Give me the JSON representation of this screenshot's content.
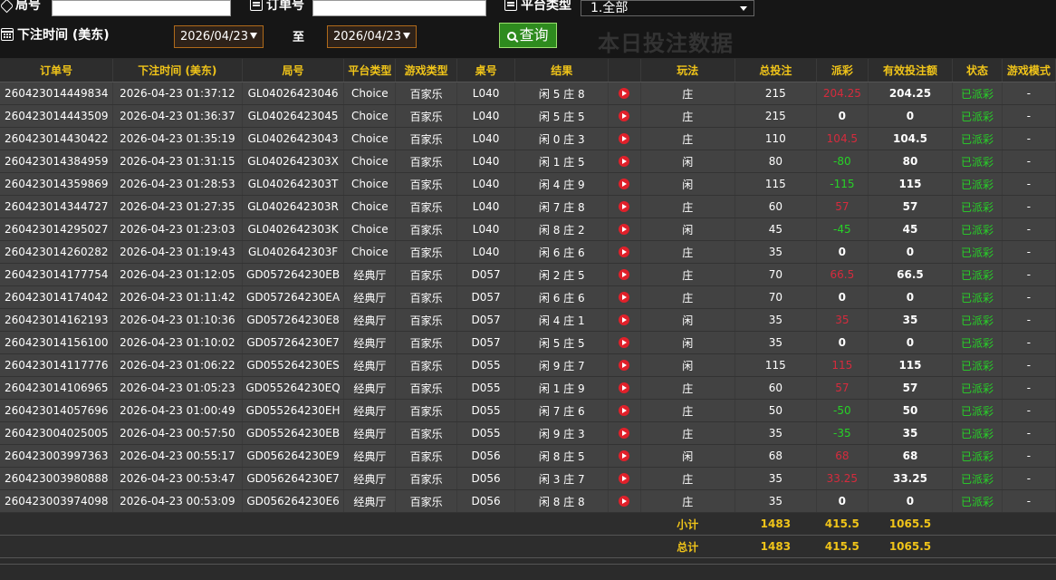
{
  "filters": {
    "round_label": "局号",
    "order_label": "订单号",
    "platform_label": "平台类型",
    "platform_selected": "1.全部",
    "time_label": "下注时间 (美东)",
    "date_from": "2026/04/23",
    "to_label": "至",
    "date_to": "2026/04/23",
    "query_label": "查询",
    "ghost_text": "本日投注数据"
  },
  "colors": {
    "header_text": "#f0c419",
    "negative": "#d62b3d",
    "positive": "#27d227",
    "query_button": "#2e8b1e"
  },
  "table": {
    "headers": [
      "订单号",
      "下注时间 (美东)",
      "局号",
      "平台类型",
      "游戏类型",
      "桌号",
      "结果",
      "",
      "玩法",
      "总投注",
      "派彩",
      "有效投注额",
      "状态",
      "游戏模式"
    ],
    "rows": [
      [
        "260423014449834",
        "2026-04-23 01:37:12",
        "GL04026423046",
        "Choice",
        "百家乐",
        "L040",
        "闲 5 庄 8",
        "庄",
        "215",
        "204.25",
        "204.25",
        "已派彩",
        "-"
      ],
      [
        "260423014443509",
        "2026-04-23 01:36:37",
        "GL04026423045",
        "Choice",
        "百家乐",
        "L040",
        "闲 5 庄 5",
        "庄",
        "215",
        "0",
        "0",
        "已派彩",
        "-"
      ],
      [
        "260423014430422",
        "2026-04-23 01:35:19",
        "GL04026423043",
        "Choice",
        "百家乐",
        "L040",
        "闲 0 庄 3",
        "庄",
        "110",
        "104.5",
        "104.5",
        "已派彩",
        "-"
      ],
      [
        "260423014384959",
        "2026-04-23 01:31:15",
        "GL0402642303X",
        "Choice",
        "百家乐",
        "L040",
        "闲 1 庄 5",
        "闲",
        "80",
        "-80",
        "80",
        "已派彩",
        "-"
      ],
      [
        "260423014359869",
        "2026-04-23 01:28:53",
        "GL0402642303T",
        "Choice",
        "百家乐",
        "L040",
        "闲 4 庄 9",
        "闲",
        "115",
        "-115",
        "115",
        "已派彩",
        "-"
      ],
      [
        "260423014344727",
        "2026-04-23 01:27:35",
        "GL0402642303R",
        "Choice",
        "百家乐",
        "L040",
        "闲 7 庄 8",
        "庄",
        "60",
        "57",
        "57",
        "已派彩",
        "-"
      ],
      [
        "260423014295027",
        "2026-04-23 01:23:03",
        "GL0402642303K",
        "Choice",
        "百家乐",
        "L040",
        "闲 8 庄 2",
        "闲",
        "45",
        "-45",
        "45",
        "已派彩",
        "-"
      ],
      [
        "260423014260282",
        "2026-04-23 01:19:43",
        "GL0402642303F",
        "Choice",
        "百家乐",
        "L040",
        "闲 6 庄 6",
        "庄",
        "35",
        "0",
        "0",
        "已派彩",
        "-"
      ],
      [
        "260423014177754",
        "2026-04-23 01:12:05",
        "GD057264230EB",
        "经典厅",
        "百家乐",
        "D057",
        "闲 2 庄 5",
        "庄",
        "70",
        "66.5",
        "66.5",
        "已派彩",
        "-"
      ],
      [
        "260423014174042",
        "2026-04-23 01:11:42",
        "GD057264230EA",
        "经典厅",
        "百家乐",
        "D057",
        "闲 6 庄 6",
        "庄",
        "70",
        "0",
        "0",
        "已派彩",
        "-"
      ],
      [
        "260423014162193",
        "2026-04-23 01:10:36",
        "GD057264230E8",
        "经典厅",
        "百家乐",
        "D057",
        "闲 4 庄 1",
        "闲",
        "35",
        "35",
        "35",
        "已派彩",
        "-"
      ],
      [
        "260423014156100",
        "2026-04-23 01:10:02",
        "GD057264230E7",
        "经典厅",
        "百家乐",
        "D057",
        "闲 5 庄 5",
        "闲",
        "35",
        "0",
        "0",
        "已派彩",
        "-"
      ],
      [
        "260423014117776",
        "2026-04-23 01:06:22",
        "GD055264230ES",
        "经典厅",
        "百家乐",
        "D055",
        "闲 9 庄 7",
        "闲",
        "115",
        "115",
        "115",
        "已派彩",
        "-"
      ],
      [
        "260423014106965",
        "2026-04-23 01:05:23",
        "GD055264230EQ",
        "经典厅",
        "百家乐",
        "D055",
        "闲 1 庄 9",
        "庄",
        "60",
        "57",
        "57",
        "已派彩",
        "-"
      ],
      [
        "260423014057696",
        "2026-04-23 01:00:49",
        "GD055264230EH",
        "经典厅",
        "百家乐",
        "D055",
        "闲 7 庄 6",
        "庄",
        "50",
        "-50",
        "50",
        "已派彩",
        "-"
      ],
      [
        "260423004025005",
        "2026-04-23 00:57:50",
        "GD055264230EB",
        "经典厅",
        "百家乐",
        "D055",
        "闲 9 庄 3",
        "庄",
        "35",
        "-35",
        "35",
        "已派彩",
        "-"
      ],
      [
        "260423003997363",
        "2026-04-23 00:55:17",
        "GD056264230E9",
        "经典厅",
        "百家乐",
        "D056",
        "闲 8 庄 5",
        "闲",
        "68",
        "68",
        "68",
        "已派彩",
        "-"
      ],
      [
        "260423003980888",
        "2026-04-23 00:53:47",
        "GD056264230E7",
        "经典厅",
        "百家乐",
        "D056",
        "闲 3 庄 7",
        "庄",
        "35",
        "33.25",
        "33.25",
        "已派彩",
        "-"
      ],
      [
        "260423003974098",
        "2026-04-23 00:53:09",
        "GD056264230E6",
        "经典厅",
        "百家乐",
        "D056",
        "闲 8 庄 8",
        "庄",
        "35",
        "0",
        "0",
        "已派彩",
        "-"
      ]
    ],
    "subtotal": {
      "label": "小计",
      "total_bet": "1483",
      "payout": "415.5",
      "valid_bet": "1065.5"
    },
    "grandtotal": {
      "label": "总计",
      "total_bet": "1483",
      "payout": "415.5",
      "valid_bet": "1065.5"
    }
  }
}
